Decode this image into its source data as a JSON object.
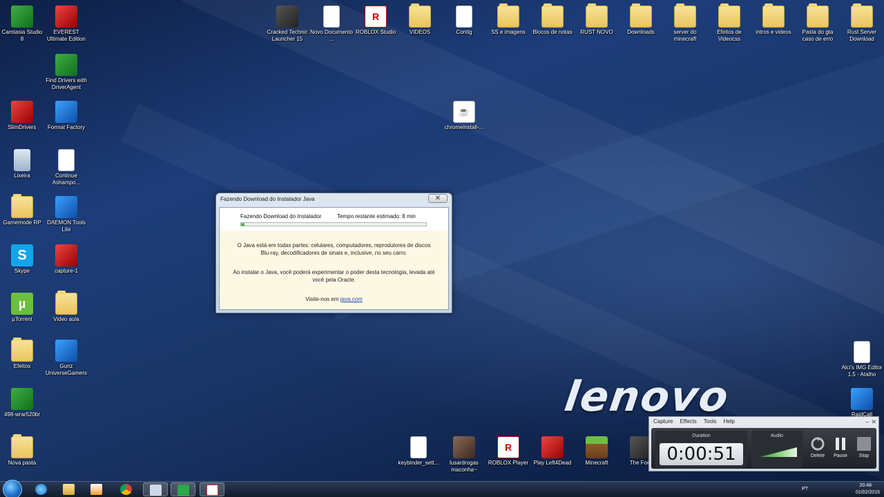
{
  "desktop": {
    "icons": [
      {
        "label": "Camtasia Studio 8",
        "icon": "camtasia-icon",
        "type": "green"
      },
      {
        "label": "EVEREST Ultimate Edition",
        "icon": "everest-icon",
        "type": "red"
      },
      {
        "label": "Find Drivers with DriverAgent",
        "icon": "driveragent-icon",
        "type": "green"
      },
      {
        "label": "SlimDrivers",
        "icon": "slimdrivers-icon",
        "type": "red"
      },
      {
        "label": "Format Factory",
        "icon": "format-factory-icon",
        "type": "blue"
      },
      {
        "label": "Lixeira",
        "icon": "recycle-bin-icon",
        "type": "recycle"
      },
      {
        "label": "Continue Ashampo...",
        "icon": "ashampoo-icon",
        "type": "doc"
      },
      {
        "label": "Gamemode RP",
        "icon": "folder-icon",
        "type": "folder"
      },
      {
        "label": "DAEMON Tools Lite",
        "icon": "daemon-tools-icon",
        "type": "blue"
      },
      {
        "label": "Skype",
        "icon": "skype-icon",
        "type": "skype"
      },
      {
        "label": "capture-1",
        "icon": "video-file-icon",
        "type": "red"
      },
      {
        "label": "µTorrent",
        "icon": "utorrent-icon",
        "type": "utorrent"
      },
      {
        "label": "Video aula",
        "icon": "folder-icon",
        "type": "folder"
      },
      {
        "label": "Efeitos",
        "icon": "folder-icon",
        "type": "folder"
      },
      {
        "label": "Gunz UniverseGamers",
        "icon": "gunz-icon",
        "type": "blue"
      },
      {
        "label": "498-wrar520br",
        "icon": "winrar-icon",
        "type": "green"
      },
      {
        "label": "Nova pasta",
        "icon": "folder-icon",
        "type": "folder"
      },
      {
        "label": "Cracked Technic Launcher 15",
        "icon": "technic-icon",
        "type": "dark"
      },
      {
        "label": "Novo Documento ...",
        "icon": "document-icon",
        "type": "doc"
      },
      {
        "label": "ROBLOX Studio",
        "icon": "roblox-icon",
        "type": "roblox"
      },
      {
        "label": "VIDEOS",
        "icon": "folder-icon",
        "type": "folder"
      },
      {
        "label": "Contig",
        "icon": "contig-icon",
        "type": "doc"
      },
      {
        "label": "SS e imagens",
        "icon": "folder-icon",
        "type": "folder"
      },
      {
        "label": "Blocos de notas",
        "icon": "folder-icon",
        "type": "folder"
      },
      {
        "label": "RUST NOVO",
        "icon": "folder-icon",
        "type": "folder"
      },
      {
        "label": "Downloads",
        "icon": "folder-icon",
        "type": "folder"
      },
      {
        "label": "server do minecraft",
        "icon": "folder-icon",
        "type": "folder"
      },
      {
        "label": "Efeitos de Videocss",
        "icon": "folder-icon",
        "type": "folder"
      },
      {
        "label": "intros e videos",
        "icon": "folder-icon",
        "type": "folder"
      },
      {
        "label": "Pasta do gta caso de erro",
        "icon": "folder-icon",
        "type": "folder"
      },
      {
        "label": "Rust Server Download",
        "icon": "folder-icon",
        "type": "folder"
      },
      {
        "label": "chromeinstall-...",
        "icon": "java-icon",
        "type": "java"
      },
      {
        "label": "Alci's IMG Editor 1.5 - Atalho",
        "icon": "img-editor-icon",
        "type": "doc"
      },
      {
        "label": "RaidCall",
        "icon": "raidcall-icon",
        "type": "blue"
      },
      {
        "label": "keybinder_sett...",
        "icon": "keybinder-icon",
        "type": "doc"
      },
      {
        "label": "lusardrogas maconha~",
        "icon": "photo-icon",
        "type": "face"
      },
      {
        "label": "ROBLOX Player",
        "icon": "roblox-icon",
        "type": "roblox"
      },
      {
        "label": "Play Left4Dead",
        "icon": "left4dead-icon",
        "type": "red"
      },
      {
        "label": "Minecraft",
        "icon": "minecraft-icon",
        "type": "mc"
      },
      {
        "label": "The Fore",
        "icon": "the-forest-icon",
        "type": "dark"
      }
    ],
    "wallpaper_brand": "lenovo"
  },
  "java_dialog": {
    "title": "Fazendo Download do Instalador Java",
    "close_glyph": "✕",
    "status": "Fazendo Download do Instalador",
    "eta": "Tempo restante estimado: 8 min",
    "progress": 0.02,
    "paragraph1": "O Java está em todas partes: celulares, computadores, reprodutores de discos Blu-ray, decodificadores de sinais e, inclusive, no seu carro.",
    "paragraph2": "Ao instalar o Java, você poderá experimentar o poder desta tecnologia, levada até você pela Oracle.",
    "visit_prefix": "Visite-nos em",
    "visit_link": "java.com"
  },
  "recorder": {
    "menu": [
      "Capture",
      "Effects",
      "Tools",
      "Help"
    ],
    "duration_label": "Duration",
    "duration": "0:00:51",
    "audio_label": "Audio",
    "delete_label": "Delete",
    "pause_label": "Pause",
    "stop_label": "Stop"
  },
  "taskbar": {
    "apps": [
      "internet-explorer-icon",
      "explorer-icon",
      "media-player-icon",
      "chrome-icon",
      "camtasia-recorder-icon",
      "camtasia-studio-icon",
      "java-installer-icon"
    ],
    "language": "PT",
    "time": "20:48",
    "date": "01/02/2015"
  }
}
